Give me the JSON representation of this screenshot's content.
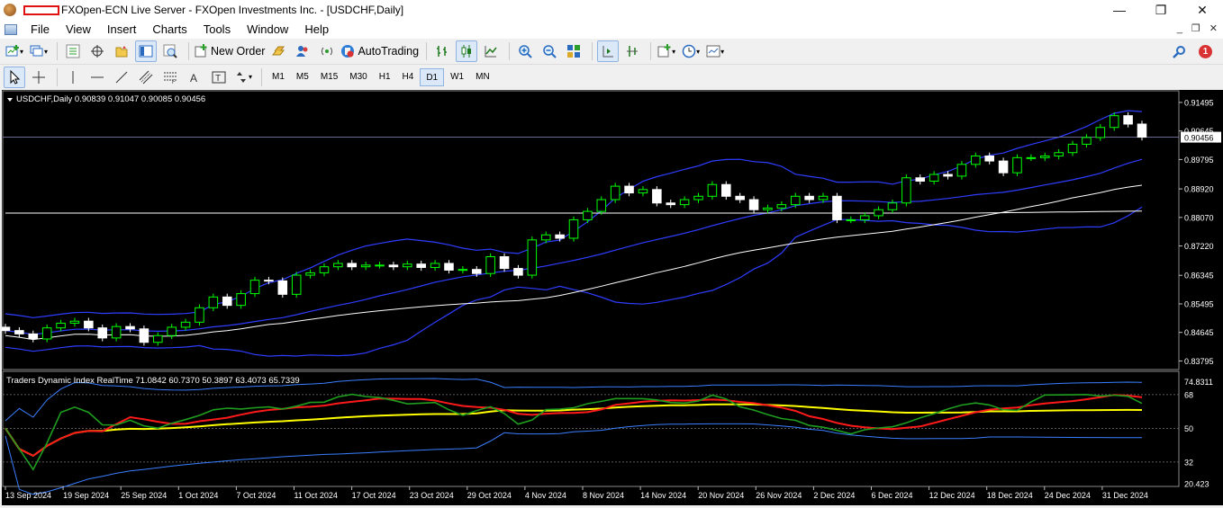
{
  "window": {
    "title": "FXOpen-ECN Live Server - FXOpen Investments Inc. - [USDCHF,Daily]",
    "controls": [
      "—",
      "❐",
      "✕"
    ]
  },
  "menu": {
    "items": [
      "File",
      "View",
      "Insert",
      "Charts",
      "Tools",
      "Window",
      "Help"
    ],
    "mdi_controls": [
      "_",
      "❐",
      "✕"
    ]
  },
  "toolbar": {
    "new_order": "New Order",
    "autotrading": "AutoTrading",
    "notification_count": "1"
  },
  "timeframes": {
    "items": [
      "M1",
      "M5",
      "M15",
      "M30",
      "H1",
      "H4",
      "D1",
      "W1",
      "MN"
    ],
    "active": "D1"
  },
  "chart": {
    "header": "USDCHF,Daily  0.90839 0.91047 0.90085 0.90456",
    "current_price_label": "0.90456",
    "price_axis": [
      "0.91495",
      "0.90645",
      "0.89795",
      "0.88920",
      "0.88070",
      "0.87220",
      "0.86345",
      "0.85495",
      "0.84645",
      "0.83795"
    ],
    "indicator_header": "Traders Dynamic Index RealTime 71.0842 60.7370 50.3897 63.4073 65.7339",
    "indicator_axis": [
      "74.8311",
      "68",
      "50",
      "32",
      "20.423"
    ],
    "date_axis": [
      "13 Sep 2024",
      "19 Sep 2024",
      "25 Sep 2024",
      "1 Oct 2024",
      "7 Oct 2024",
      "11 Oct 2024",
      "17 Oct 2024",
      "23 Oct 2024",
      "29 Oct 2024",
      "4 Nov 2024",
      "8 Nov 2024",
      "14 Nov 2024",
      "20 Nov 2024",
      "26 Nov 2024",
      "2 Dec 2024",
      "6 Dec 2024",
      "12 Dec 2024",
      "18 Dec 2024",
      "24 Dec 2024",
      "31 Dec 2024"
    ],
    "colors": {
      "background": "#000000",
      "bull_candle": "#00ff00",
      "bear_candle": "#ffffff",
      "bollinger": "#2f3dff",
      "ma_white": "#ffffff",
      "tdi_green": "#1f9e1f",
      "tdi_red": "#ff1a1a",
      "tdi_yellow": "#ffff00",
      "tdi_band": "#3a7fff"
    }
  },
  "chart_data": {
    "type": "candlestick",
    "symbol": "USDCHF",
    "timeframe": "Daily",
    "ylim": [
      0.837,
      0.916
    ],
    "closes": [
      0.847,
      0.846,
      0.8445,
      0.8478,
      0.8492,
      0.8498,
      0.8478,
      0.8448,
      0.8482,
      0.8475,
      0.8435,
      0.8455,
      0.848,
      0.8495,
      0.8538,
      0.857,
      0.8545,
      0.858,
      0.862,
      0.8618,
      0.8578,
      0.8635,
      0.8642,
      0.866,
      0.867,
      0.866,
      0.8665,
      0.8665,
      0.866,
      0.8668,
      0.8658,
      0.867,
      0.865,
      0.8652,
      0.864,
      0.869,
      0.8655,
      0.8635,
      0.874,
      0.8755,
      0.8745,
      0.88,
      0.8825,
      0.886,
      0.89,
      0.888,
      0.889,
      0.885,
      0.8845,
      0.886,
      0.887,
      0.8905,
      0.887,
      0.886,
      0.883,
      0.8835,
      0.8845,
      0.887,
      0.886,
      0.887,
      0.88,
      0.88,
      0.8812,
      0.883,
      0.885,
      0.8925,
      0.8915,
      0.8935,
      0.893,
      0.8965,
      0.899,
      0.8975,
      0.894,
      0.8985,
      0.8985,
      0.899,
      0.9,
      0.9025,
      0.9045,
      0.9075,
      0.911,
      0.9085,
      0.9046
    ]
  }
}
